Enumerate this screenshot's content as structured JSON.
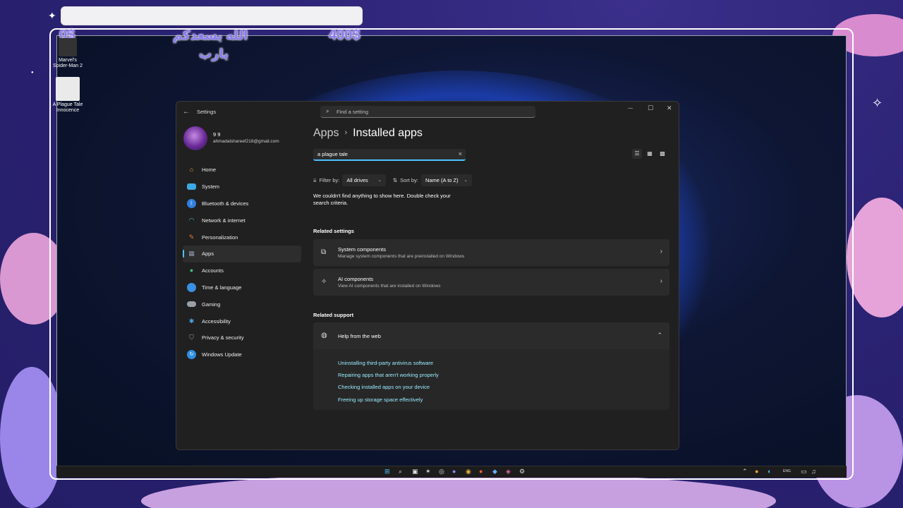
{
  "overlay": {
    "left_amount": "0$",
    "arabic_line1": "الله يسعدكم",
    "arabic_line2": "يارب",
    "right_amount": "400$"
  },
  "desktop_icons": [
    {
      "label": "Marvel's Spider-Man 2"
    },
    {
      "label": "A Plague Tale Innocence"
    }
  ],
  "window": {
    "app_title": "Settings",
    "search_placeholder": "Find a setting",
    "controls": {
      "minimize": "—",
      "maximize": "☐",
      "close": "✕"
    }
  },
  "profile": {
    "name": "9 9",
    "email": "ahmadalshareef218@gmail.com"
  },
  "nav": [
    {
      "label": "Home",
      "icon": "home-icon",
      "color": "#e8a33b",
      "active": false
    },
    {
      "label": "System",
      "icon": "system-icon",
      "color": "#3da8e6",
      "active": false
    },
    {
      "label": "Bluetooth & devices",
      "icon": "bluetooth-icon",
      "color": "#2f7fe0",
      "active": false
    },
    {
      "label": "Network & internet",
      "icon": "wifi-icon",
      "color": "#48b8e8",
      "active": false
    },
    {
      "label": "Personalization",
      "icon": "brush-icon",
      "color": "#e07a3a",
      "active": false
    },
    {
      "label": "Apps",
      "icon": "apps-icon",
      "color": "#8a96b0",
      "active": true
    },
    {
      "label": "Accounts",
      "icon": "accounts-icon",
      "color": "#3cc27a",
      "active": false
    },
    {
      "label": "Time & language",
      "icon": "globe-clock-icon",
      "color": "#3a8fe0",
      "active": false
    },
    {
      "label": "Gaming",
      "icon": "gamepad-icon",
      "color": "#9aa0aa",
      "active": false
    },
    {
      "label": "Accessibility",
      "icon": "accessibility-icon",
      "color": "#4aa6e8",
      "active": false
    },
    {
      "label": "Privacy & security",
      "icon": "shield-icon",
      "color": "#9aa0aa",
      "active": false
    },
    {
      "label": "Windows Update",
      "icon": "update-icon",
      "color": "#2f8fe0",
      "active": false
    }
  ],
  "content": {
    "breadcrumb_parent": "Apps",
    "breadcrumb_sep": "›",
    "breadcrumb_current": "Installed apps",
    "search_value": "a plague tale",
    "filter_label": "Filter by:",
    "filter_value": "All drives",
    "sort_label": "Sort by:",
    "sort_value": "Name (A to Z)",
    "empty_message": "We couldn't find anything to show here. Double check your search criteria.",
    "related_settings_heading": "Related settings",
    "related_settings": [
      {
        "title": "System components",
        "subtitle": "Manage system components that are preinstalled on Windows"
      },
      {
        "title": "AI components",
        "subtitle": "View AI components that are installed on Windows"
      }
    ],
    "related_support_heading": "Related support",
    "help_title": "Help from the web",
    "help_links": [
      "Uninstalling third-party antivirus software",
      "Repairing apps that aren't working properly",
      "Checking installed apps on your device",
      "Freeing up storage space effectively"
    ]
  },
  "taskbar": {
    "language": "ENG"
  }
}
